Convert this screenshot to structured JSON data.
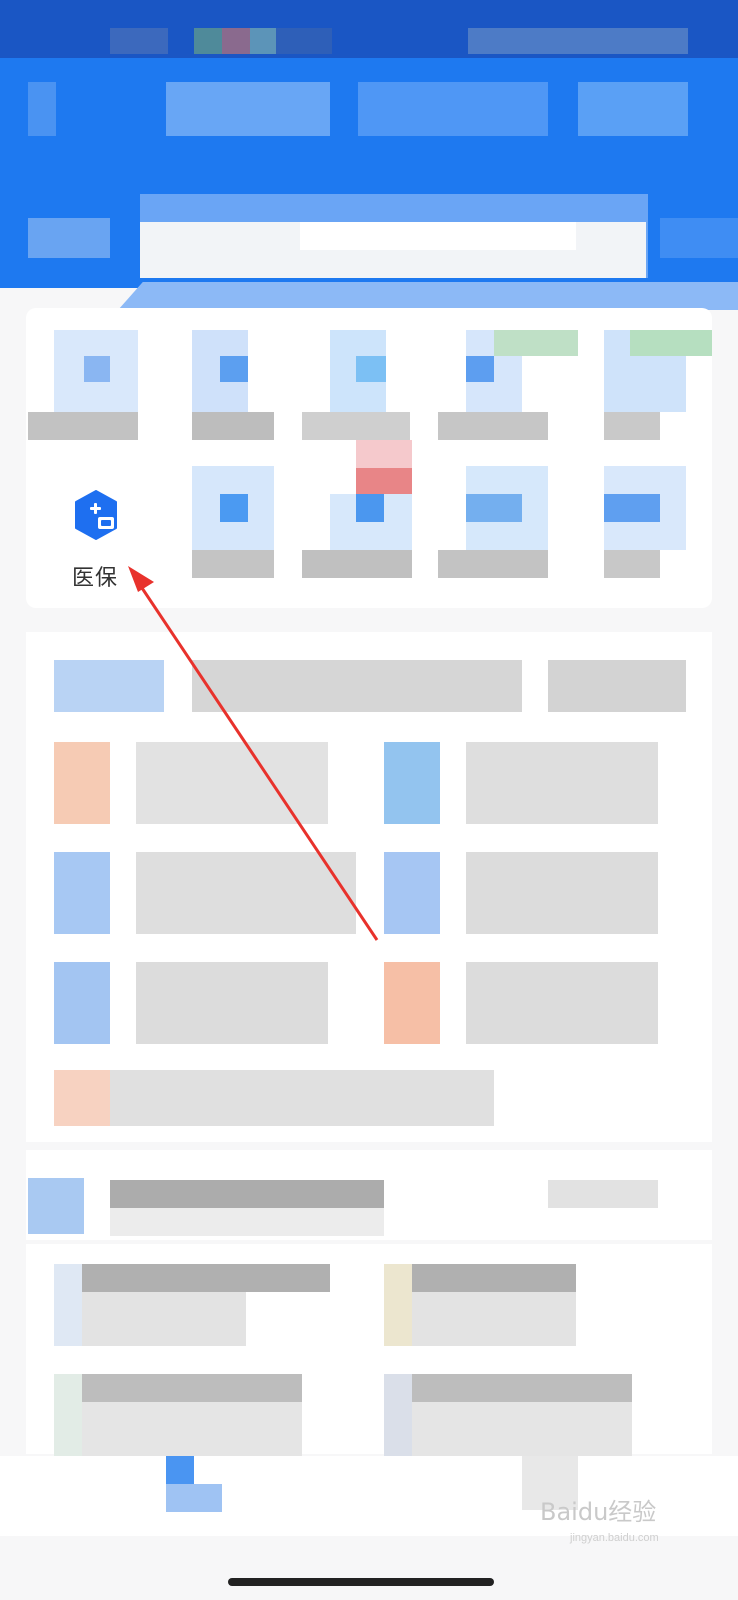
{
  "screen": {
    "medical_insurance": {
      "label": "医保",
      "icon": "medical-insurance-shield-icon",
      "accent": "#1e6ff0"
    },
    "watermark": {
      "text": "Baidu经验",
      "sub": "jingyan.baidu.com"
    },
    "colors": {
      "header": "#1e79f0",
      "statusbar": "#1a56c4",
      "annotation_arrow": "#e8322c"
    }
  }
}
